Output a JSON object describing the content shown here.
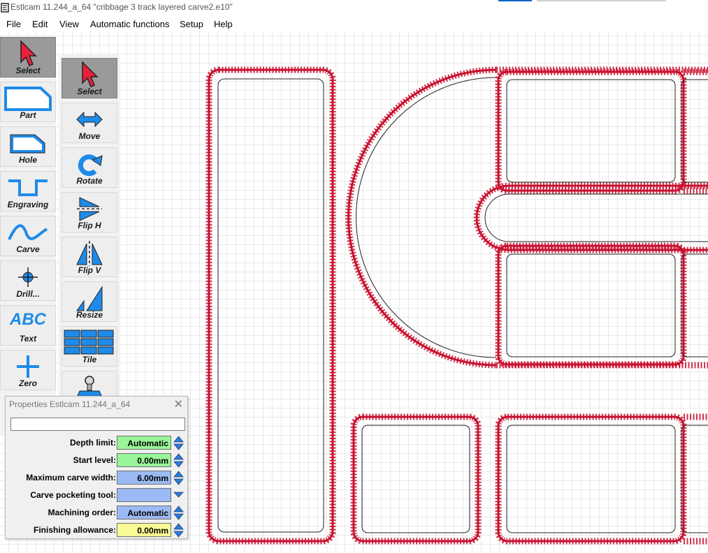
{
  "window": {
    "title": "Estlcam 11.244_a_64 \"cribbage 3 track layered carve2.e10\""
  },
  "menu": [
    "File",
    "Edit",
    "View",
    "Automatic functions",
    "Setup",
    "Help"
  ],
  "left_toolbar": [
    {
      "label": "Select",
      "icon": "select-arrow-icon",
      "active": true
    },
    {
      "label": "Part",
      "icon": "part-outline-icon"
    },
    {
      "label": "Hole",
      "icon": "hole-outline-icon"
    },
    {
      "label": "Engraving",
      "icon": "engraving-icon"
    },
    {
      "label": "Carve",
      "icon": "carve-icon"
    },
    {
      "label": "Drill...",
      "icon": "drill-crosshair-icon"
    },
    {
      "label": "ABC",
      "icon": "text-abc-icon"
    },
    {
      "label": "Text",
      "icon": "text-abc-icon"
    },
    {
      "label": "Zero",
      "icon": "zero-plus-icon"
    }
  ],
  "second_toolbar": [
    {
      "label": "Select",
      "icon": "select-arrow-icon",
      "active": true
    },
    {
      "label": "Move",
      "icon": "move-arrows-icon"
    },
    {
      "label": "Rotate",
      "icon": "rotate-icon"
    },
    {
      "label": "Flip H",
      "icon": "flip-horizontal-icon"
    },
    {
      "label": "Flip V",
      "icon": "flip-vertical-icon"
    },
    {
      "label": "Resize",
      "icon": "resize-icon"
    },
    {
      "label": "Tile",
      "icon": "tile-grid-icon"
    },
    {
      "label": "",
      "icon": "stamp-icon"
    }
  ],
  "properties": {
    "title": "Properties Estlcam 11.244_a_64",
    "input_value": "",
    "rows": [
      {
        "label": "Depth limit:",
        "value": "Automatic",
        "color": "#98f598"
      },
      {
        "label": "Start level:",
        "value": "0.00mm",
        "color": "#98f598"
      },
      {
        "label": "Maximum carve width:",
        "value": "6.00mm",
        "color": "#9bbaf5"
      },
      {
        "label": "Carve pocketing tool:",
        "value": "",
        "color": "#9bbaf5"
      },
      {
        "label": "Machining order:",
        "value": "Automatic",
        "color": "#9bbaf5"
      },
      {
        "label": "Finishing allowance:",
        "value": "0.00mm",
        "color": "#fbfb96"
      }
    ]
  },
  "colors": {
    "toolpath": "#c8102e",
    "grid": "#d4d4d4",
    "icon_blue": "#1e8be8",
    "select_red": "#e8213c"
  }
}
